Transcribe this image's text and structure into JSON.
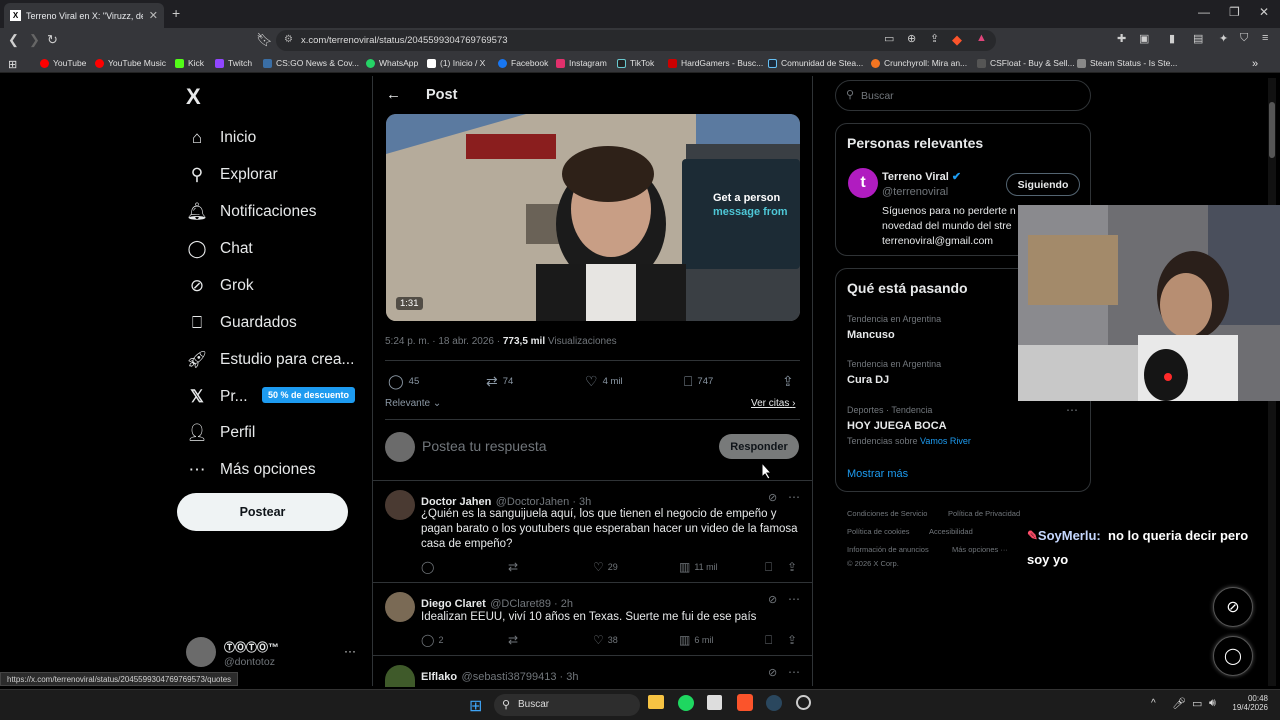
{
  "browser": {
    "tab_title": "Terreno Viral en X: \"Viruzz, despu",
    "tab_favicon": "X",
    "url": "x.com/terrenoviral/status/2045599304769769573",
    "bookmarks": [
      "YouTube",
      "YouTube Music",
      "Kick",
      "Twitch",
      "CS:GO News & Cov...",
      "WhatsApp",
      "(1) Inicio / X",
      "Facebook",
      "Instagram",
      "TikTok",
      "HardGamers - Busc...",
      "Comunidad de Stea...",
      "Crunchyroll: Mira an...",
      "CSFloat - Buy & Sell...",
      "Steam Status - Is Ste..."
    ],
    "status_url": "https://x.com/terrenoviral/status/2045599304769769573/quotes"
  },
  "nav": {
    "logo": "X",
    "items": [
      {
        "label": "Inicio",
        "icon": "home-icon"
      },
      {
        "label": "Explorar",
        "icon": "search-icon"
      },
      {
        "label": "Notificaciones",
        "icon": "bell-icon"
      },
      {
        "label": "Chat",
        "icon": "chat-icon"
      },
      {
        "label": "Grok",
        "icon": "grok-icon"
      },
      {
        "label": "Guardados",
        "icon": "bookmark-icon"
      },
      {
        "label": "Estudio para crea...",
        "icon": "rocket-icon"
      },
      {
        "label": "Pr...",
        "icon": "x-icon"
      },
      {
        "label": "Perfil",
        "icon": "person-icon"
      },
      {
        "label": "Más opciones",
        "icon": "more-icon"
      }
    ],
    "premium_badge": "50 % de descuento",
    "post_button": "Postear",
    "account_name": "ⓉⓄⓉⓄ™",
    "account_handle": "@dontotoz",
    "account_more": "···"
  },
  "post": {
    "header": "Post",
    "video_duration": "1:31",
    "video_sign1": "Get a person",
    "video_sign2": "message from",
    "timestamp": "5:24 p. m. · 18 abr. 2026 · ",
    "views_count": "773,5 mil",
    "views_label": "Visualizaciones",
    "stats": {
      "replies": "45",
      "reposts": "74",
      "likes": "4 mil",
      "bookmarks": "747"
    },
    "sort_label": "Relevante",
    "quotes_link": "Ver citas",
    "reply_placeholder": "Postea tu respuesta",
    "reply_button": "Responder"
  },
  "replies": [
    {
      "name": "Doctor Jahen",
      "handle": "@DoctorJahen · 3h",
      "text": "¿Quién es la sanguijuela aquí, los que tienen el negocio de empeño y pagan barato o los youtubers que esperaban hacer un video de la famosa casa de empeño?",
      "likes": "29",
      "views": "11 mil"
    },
    {
      "name": "Diego Claret",
      "handle": "@DClaret89 · 2h",
      "text": "Idealizan EEUU, viví 10 años en Texas. Suerte me fui de ese país",
      "replies": "2",
      "likes": "38",
      "views": "6 mil"
    },
    {
      "name": "Elflako",
      "handle": "@sebasti38799413 · 3h"
    }
  ],
  "sidebar": {
    "search_placeholder": "Buscar",
    "relevant_title": "Personas relevantes",
    "person": {
      "name": "Terreno Viral",
      "handle": "@terrenoviral",
      "follow_button": "Siguiendo",
      "bio_lines": [
        "Síguenos para no perderte n",
        "novedad del mundo del stre",
        "terrenoviral@gmail.com"
      ]
    },
    "trending_title": "Qué está pasando",
    "trends": [
      {
        "context": "Tendencia en Argentina",
        "name": "Mancuso"
      },
      {
        "context": "Tendencia en Argentina",
        "name": "Cura DJ"
      },
      {
        "context": "Deportes · Tendencia",
        "name": "HOY JUEGA BOCA",
        "extra_prefix": "Tendencias sobre ",
        "extra_link": "Vamos River"
      }
    ],
    "show_more": "Mostrar más",
    "footer": [
      "Condiciones de Servicio",
      "Política de Privacidad",
      "Política de cookies",
      "Accesibilidad",
      "Información de anuncios",
      "Más opciones ···",
      "© 2026 X Corp."
    ]
  },
  "overlay": {
    "chat_user": "SoyMerlu",
    "chat_sep": ":",
    "chat_message": "no lo queria decir pero soy yo"
  },
  "taskbar": {
    "search": "Buscar",
    "time": "00:48",
    "date": "19/4/2026"
  },
  "colors": {
    "accent": "#1d9bf0",
    "bg": "#000000",
    "border": "#2f3336",
    "muted": "#71767b",
    "chat_name": "#c6d8ff"
  }
}
